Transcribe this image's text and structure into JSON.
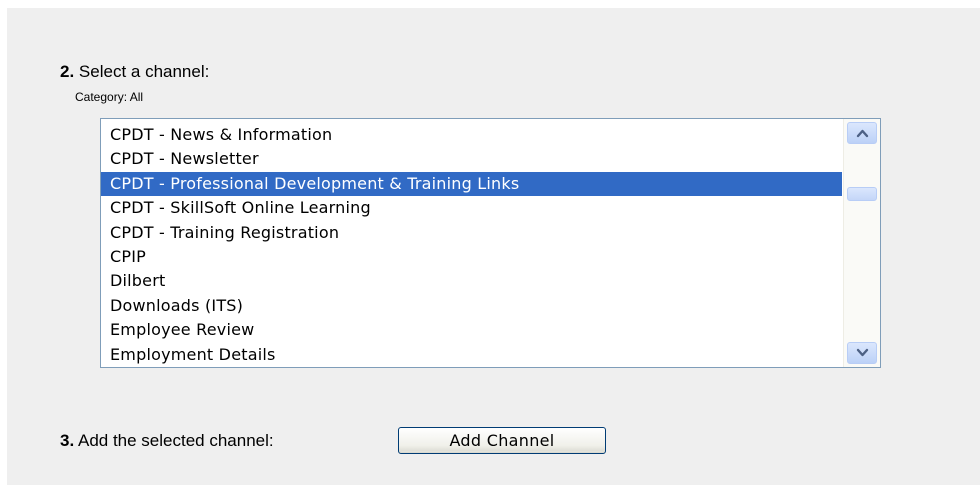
{
  "step2": {
    "number": "2.",
    "label": "Select a channel:",
    "category": "Category: All"
  },
  "channels": {
    "options": [
      "CPDT - News & Information",
      "CPDT - Newsletter",
      "CPDT - Professional Development & Training Links",
      "CPDT - SkillSoft Online Learning",
      "CPDT - Training Registration",
      "CPIP",
      "Dilbert",
      "Downloads (ITS)",
      "Employee Review",
      "Employment Details"
    ],
    "selected": "CPDT - Professional Development & Training Links",
    "scroll_position": 0.12
  },
  "step3": {
    "number": "3.",
    "label": "Add the selected channel:",
    "button_label": "Add Channel"
  },
  "colors": {
    "panel_bg": "#efefef",
    "selection": "#316ac5",
    "list_border": "#7f9db9"
  },
  "icons": {
    "scroll_up": "chevron-up-icon",
    "scroll_down": "chevron-down-icon"
  }
}
